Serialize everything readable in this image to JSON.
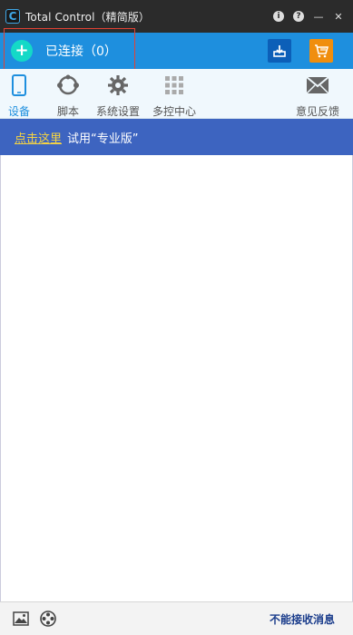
{
  "window": {
    "logo_letter": "C",
    "title": "Total Control（精简版）",
    "controls": {
      "info": "i",
      "help": "?",
      "minimize": "—",
      "close": "✕"
    }
  },
  "connect": {
    "add_symbol": "+",
    "status_text": "已连接（0）",
    "icons": [
      "download-icon",
      "cart-icon"
    ]
  },
  "tabs": [
    {
      "label": "设备",
      "icon": "phone-icon",
      "active": true
    },
    {
      "label": "脚本",
      "icon": "script-icon",
      "active": false
    },
    {
      "label": "系统设置",
      "icon": "gear-icon",
      "active": false
    },
    {
      "label": "多控中心",
      "icon": "grid-icon",
      "active": false
    },
    {
      "label": "意见反馈",
      "icon": "mail-icon",
      "active": false
    }
  ],
  "promo": {
    "link_text": "点击这里",
    "text": "试用“专业版”"
  },
  "footer": {
    "icons": [
      "image-icon",
      "film-reel-icon"
    ],
    "notify_text": "不能接收消息"
  },
  "colors": {
    "titlebar": "#2b2b2b",
    "connect_bar": "#1e8fde",
    "add_button": "#14d9c7",
    "promo_bar": "#3d64c0",
    "promo_link": "#f7d441",
    "active_tab": "#1e8fde",
    "highlight": "#e34234"
  }
}
